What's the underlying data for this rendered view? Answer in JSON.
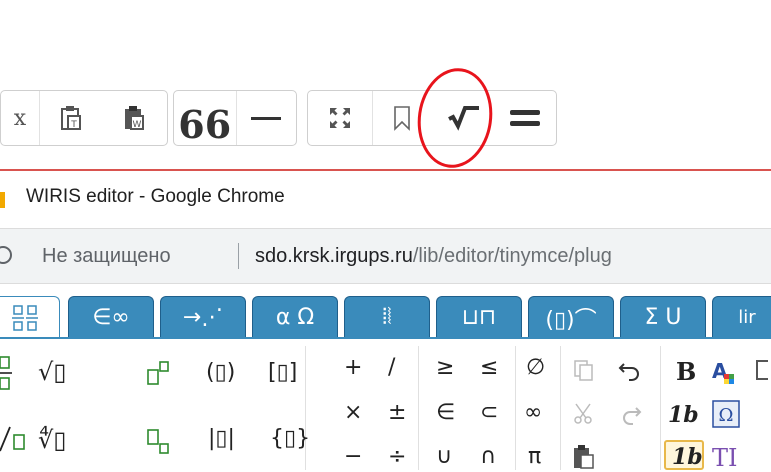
{
  "toolbar": {
    "partial_glyph": "x",
    "quote_glyph": "66"
  },
  "chrome": {
    "window_title": "WIRIS editor - Google Chrome",
    "security_label": "Не защищено",
    "url_host": "sdo.krsk.irgups.ru",
    "url_path": "/lib/editor/tinymce/plug"
  },
  "wiris": {
    "tabs": [
      {
        "label": "∈∞"
      },
      {
        "label": "→⋰"
      },
      {
        "label": "α Ω"
      },
      {
        "label": "⦙⦚"
      },
      {
        "label": "⊔⊓"
      },
      {
        "label": "(▯)⌒"
      },
      {
        "label": "Σ U"
      },
      {
        "label": "lir"
      }
    ],
    "symbols": {
      "sqrt": "√▯",
      "nroot": "∜▯",
      "sup": "▯▫",
      "sub": "▯▫",
      "paren": "(▯)",
      "bracket": "[▯]",
      "abs": "|▯|",
      "brace": "{▯}",
      "plus": "+",
      "slash": "/",
      "times": "×",
      "plusminus": "±",
      "minus": "−",
      "divide": "÷",
      "geq": "≥",
      "leq": "≤",
      "in": "∈",
      "subset": "⊂",
      "union": "∪",
      "intersect": "∩",
      "emptyset": "∅",
      "infinity": "∞",
      "pi": "π",
      "bold": "B",
      "italic_1b": "1b",
      "italic_1b_box": "1b",
      "ti": "TI"
    }
  }
}
